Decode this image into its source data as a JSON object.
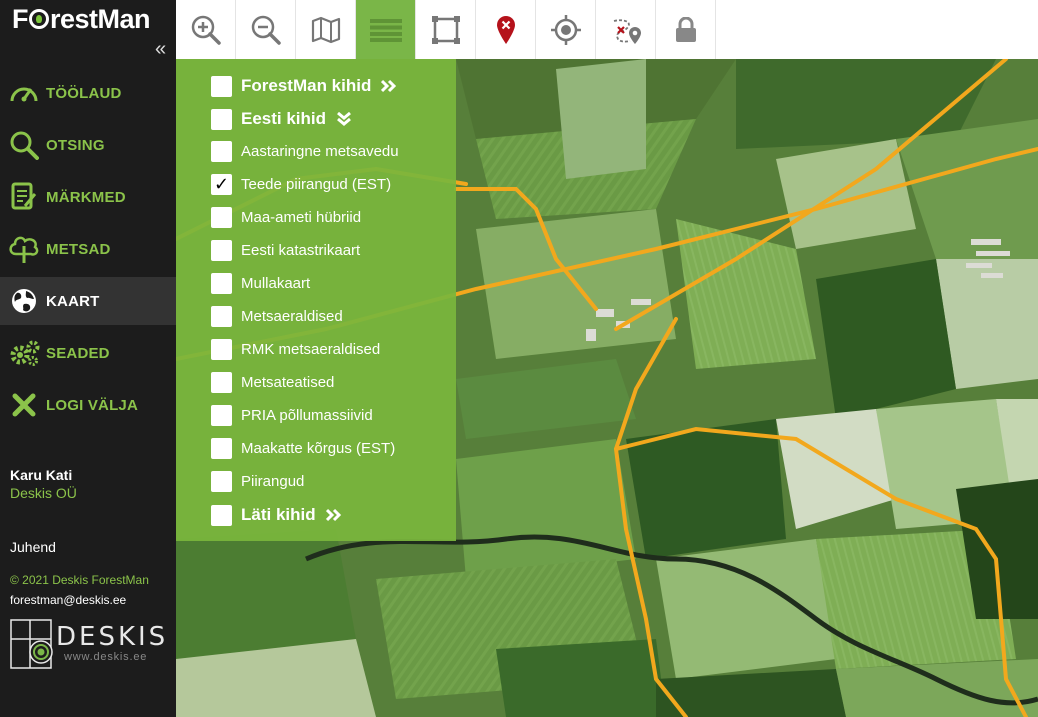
{
  "app": {
    "logo": "ForestMan"
  },
  "sidebar": {
    "collapse_icon": "double-chevron-left-icon",
    "items": [
      {
        "label": "TÖÖLAUD",
        "icon": "dashboard-icon",
        "active": false
      },
      {
        "label": "OTSING",
        "icon": "search-icon",
        "active": false
      },
      {
        "label": "MÄRKMED",
        "icon": "notes-icon",
        "active": false
      },
      {
        "label": "METSAD",
        "icon": "tree-icon",
        "active": false
      },
      {
        "label": "KAART",
        "icon": "globe-icon",
        "active": true
      },
      {
        "label": "SEADED",
        "icon": "gears-icon",
        "active": false
      },
      {
        "label": "LOGI VÄLJA",
        "icon": "close-icon",
        "active": false
      }
    ],
    "user": {
      "name": "Karu Kati",
      "org": "Deskis OÜ"
    },
    "guide": "Juhend",
    "copyright": "© 2021 Deskis ForestMan",
    "email": "forestman@deskis.ee",
    "partner_logo": {
      "text": "DESKIS",
      "url": "www.deskis.ee"
    }
  },
  "toolbar": [
    {
      "icon": "zoom-in-icon",
      "active": false
    },
    {
      "icon": "zoom-out-icon",
      "active": false
    },
    {
      "icon": "map-layers-icon",
      "active": false
    },
    {
      "icon": "list-icon",
      "active": true
    },
    {
      "icon": "draw-area-icon",
      "active": false
    },
    {
      "icon": "marker-remove-icon",
      "active": false
    },
    {
      "icon": "locate-icon",
      "active": false
    },
    {
      "icon": "route-icon",
      "active": false
    },
    {
      "icon": "lock-icon",
      "active": false
    }
  ],
  "layers": [
    {
      "label": "ForestMan kihid",
      "group": true,
      "checked": false,
      "chevron": "right"
    },
    {
      "label": "Eesti kihid",
      "group": true,
      "checked": false,
      "chevron": "down"
    },
    {
      "label": "Aastaringne metsavedu",
      "group": false,
      "checked": false
    },
    {
      "label": "Teede piirangud (EST)",
      "group": false,
      "checked": true
    },
    {
      "label": "Maa-ameti hübriid",
      "group": false,
      "checked": false
    },
    {
      "label": "Eesti katastrikaart",
      "group": false,
      "checked": false
    },
    {
      "label": "Mullakaart",
      "group": false,
      "checked": false
    },
    {
      "label": "Metsaeraldised",
      "group": false,
      "checked": false
    },
    {
      "label": "RMK metsaeraldised",
      "group": false,
      "checked": false
    },
    {
      "label": "Metsateatised",
      "group": false,
      "checked": false
    },
    {
      "label": "PRIA põllumassiivid",
      "group": false,
      "checked": false
    },
    {
      "label": "Maakatte kõrgus (EST)",
      "group": false,
      "checked": false
    },
    {
      "label": "Piirangud",
      "group": false,
      "checked": false
    },
    {
      "label": "Läti kihid",
      "group": true,
      "checked": false,
      "chevron": "right"
    }
  ],
  "colors": {
    "accent": "#7ab648",
    "nav_label": "#8bc34a",
    "road": "#f2a81d",
    "sidebar_bg": "#1c1c1c"
  }
}
